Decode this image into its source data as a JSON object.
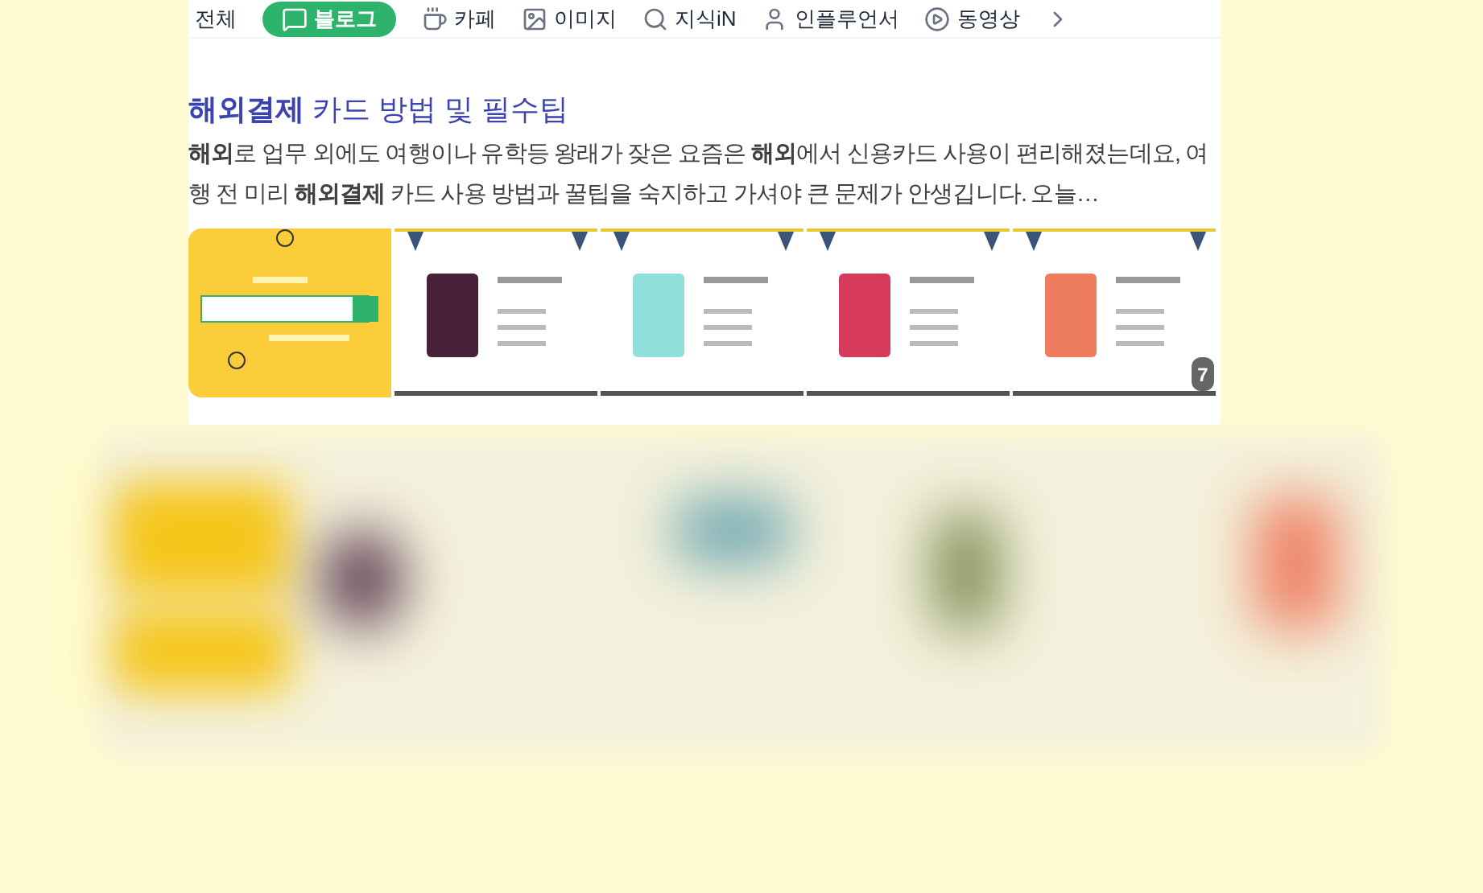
{
  "tabs": [
    {
      "label": "전체",
      "selected": false,
      "kind": "plain"
    },
    {
      "label": "블로그",
      "selected": true,
      "kind": "blog"
    },
    {
      "label": "카페",
      "selected": false,
      "kind": "cafe"
    },
    {
      "label": "이미지",
      "selected": false,
      "kind": "images"
    },
    {
      "label": "지식iN",
      "selected": false,
      "kind": "qna"
    },
    {
      "label": "인플루언서",
      "selected": false,
      "kind": "influencer"
    },
    {
      "label": "동영상",
      "selected": false,
      "kind": "video"
    }
  ],
  "result": {
    "title": "**해외결제** 카드 방법 및 필수팁",
    "snippet": "**해외**로 업무 외에도 여행이나 유학등 왕래가 잦은 요즘은 **해외**에서 신용카드 사용이 편리해졌는데요, 여행 전 미리 **해외결제** 카드 사용 방법과 꿀팁을 숙지하고 가셔야 큰 문제가 안생깁니다. 오늘…",
    "more_count": "7"
  }
}
